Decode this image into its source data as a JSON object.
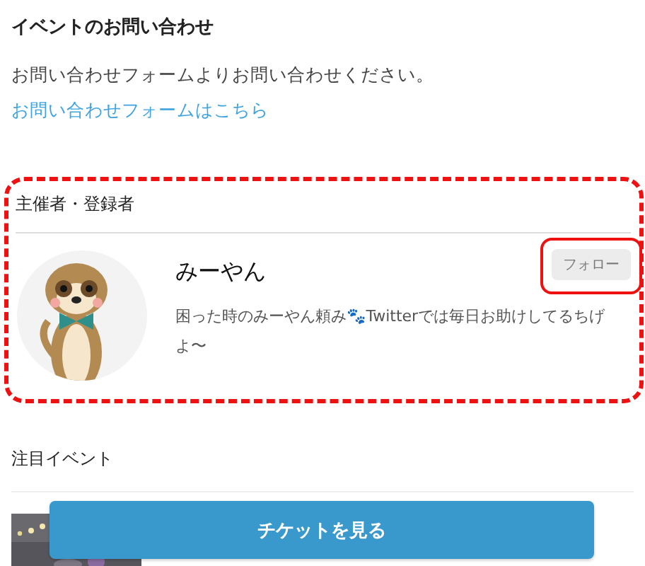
{
  "contact": {
    "heading": "イベントのお問い合わせ",
    "text": "お問い合わせフォームよりお問い合わせください。",
    "link": "お問い合わせフォームはこちら"
  },
  "organizer": {
    "heading": "主催者・登録者",
    "name": "みーやん",
    "follow_button": "フォロー",
    "bio": "困った時のみーやん頼み🐾Twitterでは毎日お助けしてるちげよ〜"
  },
  "featured": {
    "heading": "注目イベント"
  },
  "ticket_button": "チケットを見る"
}
